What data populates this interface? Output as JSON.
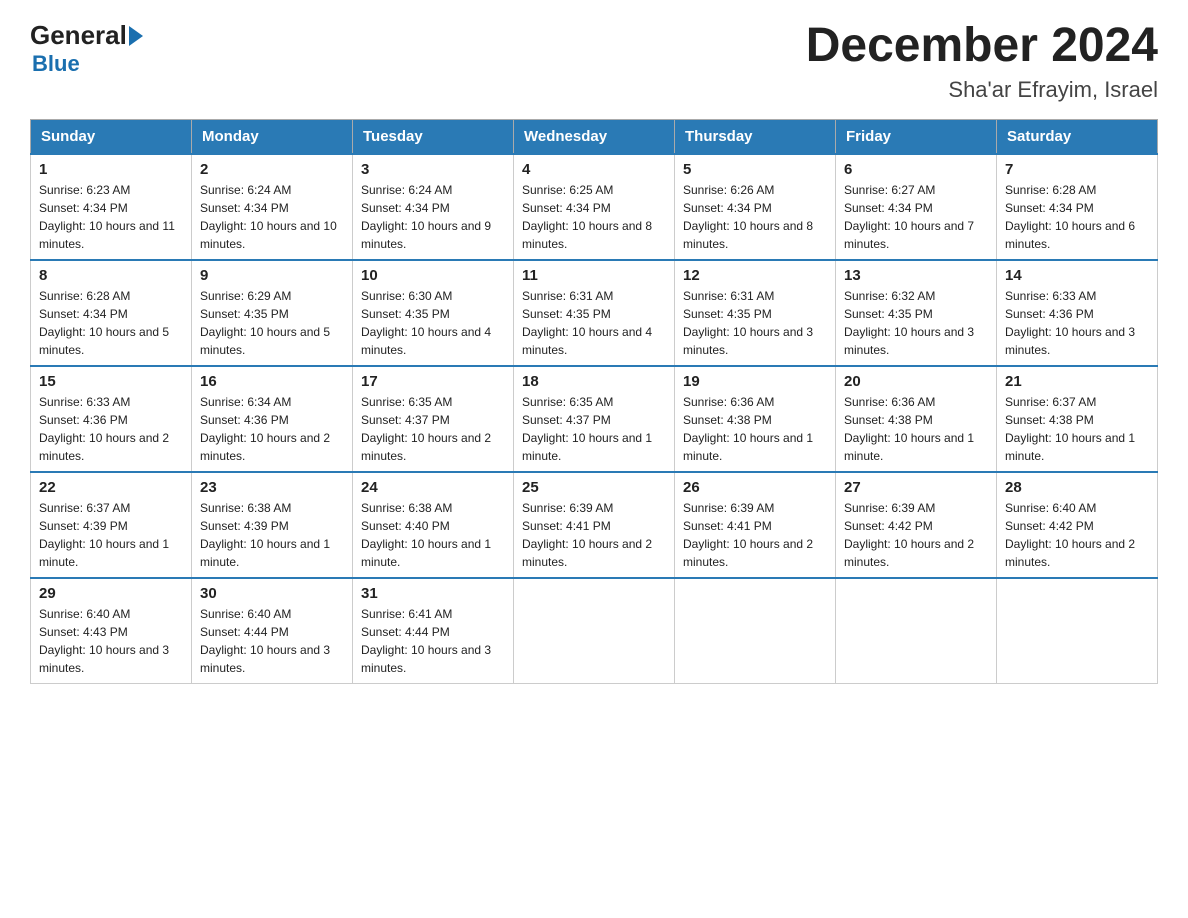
{
  "header": {
    "logo_line1": "General",
    "logo_line2": "Blue",
    "title": "December 2024",
    "subtitle": "Sha'ar Efrayim, Israel"
  },
  "days_of_week": [
    "Sunday",
    "Monday",
    "Tuesday",
    "Wednesday",
    "Thursday",
    "Friday",
    "Saturday"
  ],
  "weeks": [
    [
      {
        "day": "1",
        "sunrise": "6:23 AM",
        "sunset": "4:34 PM",
        "daylight": "10 hours and 11 minutes."
      },
      {
        "day": "2",
        "sunrise": "6:24 AM",
        "sunset": "4:34 PM",
        "daylight": "10 hours and 10 minutes."
      },
      {
        "day": "3",
        "sunrise": "6:24 AM",
        "sunset": "4:34 PM",
        "daylight": "10 hours and 9 minutes."
      },
      {
        "day": "4",
        "sunrise": "6:25 AM",
        "sunset": "4:34 PM",
        "daylight": "10 hours and 8 minutes."
      },
      {
        "day": "5",
        "sunrise": "6:26 AM",
        "sunset": "4:34 PM",
        "daylight": "10 hours and 8 minutes."
      },
      {
        "day": "6",
        "sunrise": "6:27 AM",
        "sunset": "4:34 PM",
        "daylight": "10 hours and 7 minutes."
      },
      {
        "day": "7",
        "sunrise": "6:28 AM",
        "sunset": "4:34 PM",
        "daylight": "10 hours and 6 minutes."
      }
    ],
    [
      {
        "day": "8",
        "sunrise": "6:28 AM",
        "sunset": "4:34 PM",
        "daylight": "10 hours and 5 minutes."
      },
      {
        "day": "9",
        "sunrise": "6:29 AM",
        "sunset": "4:35 PM",
        "daylight": "10 hours and 5 minutes."
      },
      {
        "day": "10",
        "sunrise": "6:30 AM",
        "sunset": "4:35 PM",
        "daylight": "10 hours and 4 minutes."
      },
      {
        "day": "11",
        "sunrise": "6:31 AM",
        "sunset": "4:35 PM",
        "daylight": "10 hours and 4 minutes."
      },
      {
        "day": "12",
        "sunrise": "6:31 AM",
        "sunset": "4:35 PM",
        "daylight": "10 hours and 3 minutes."
      },
      {
        "day": "13",
        "sunrise": "6:32 AM",
        "sunset": "4:35 PM",
        "daylight": "10 hours and 3 minutes."
      },
      {
        "day": "14",
        "sunrise": "6:33 AM",
        "sunset": "4:36 PM",
        "daylight": "10 hours and 3 minutes."
      }
    ],
    [
      {
        "day": "15",
        "sunrise": "6:33 AM",
        "sunset": "4:36 PM",
        "daylight": "10 hours and 2 minutes."
      },
      {
        "day": "16",
        "sunrise": "6:34 AM",
        "sunset": "4:36 PM",
        "daylight": "10 hours and 2 minutes."
      },
      {
        "day": "17",
        "sunrise": "6:35 AM",
        "sunset": "4:37 PM",
        "daylight": "10 hours and 2 minutes."
      },
      {
        "day": "18",
        "sunrise": "6:35 AM",
        "sunset": "4:37 PM",
        "daylight": "10 hours and 1 minute."
      },
      {
        "day": "19",
        "sunrise": "6:36 AM",
        "sunset": "4:38 PM",
        "daylight": "10 hours and 1 minute."
      },
      {
        "day": "20",
        "sunrise": "6:36 AM",
        "sunset": "4:38 PM",
        "daylight": "10 hours and 1 minute."
      },
      {
        "day": "21",
        "sunrise": "6:37 AM",
        "sunset": "4:38 PM",
        "daylight": "10 hours and 1 minute."
      }
    ],
    [
      {
        "day": "22",
        "sunrise": "6:37 AM",
        "sunset": "4:39 PM",
        "daylight": "10 hours and 1 minute."
      },
      {
        "day": "23",
        "sunrise": "6:38 AM",
        "sunset": "4:39 PM",
        "daylight": "10 hours and 1 minute."
      },
      {
        "day": "24",
        "sunrise": "6:38 AM",
        "sunset": "4:40 PM",
        "daylight": "10 hours and 1 minute."
      },
      {
        "day": "25",
        "sunrise": "6:39 AM",
        "sunset": "4:41 PM",
        "daylight": "10 hours and 2 minutes."
      },
      {
        "day": "26",
        "sunrise": "6:39 AM",
        "sunset": "4:41 PM",
        "daylight": "10 hours and 2 minutes."
      },
      {
        "day": "27",
        "sunrise": "6:39 AM",
        "sunset": "4:42 PM",
        "daylight": "10 hours and 2 minutes."
      },
      {
        "day": "28",
        "sunrise": "6:40 AM",
        "sunset": "4:42 PM",
        "daylight": "10 hours and 2 minutes."
      }
    ],
    [
      {
        "day": "29",
        "sunrise": "6:40 AM",
        "sunset": "4:43 PM",
        "daylight": "10 hours and 3 minutes."
      },
      {
        "day": "30",
        "sunrise": "6:40 AM",
        "sunset": "4:44 PM",
        "daylight": "10 hours and 3 minutes."
      },
      {
        "day": "31",
        "sunrise": "6:41 AM",
        "sunset": "4:44 PM",
        "daylight": "10 hours and 3 minutes."
      },
      null,
      null,
      null,
      null
    ]
  ]
}
